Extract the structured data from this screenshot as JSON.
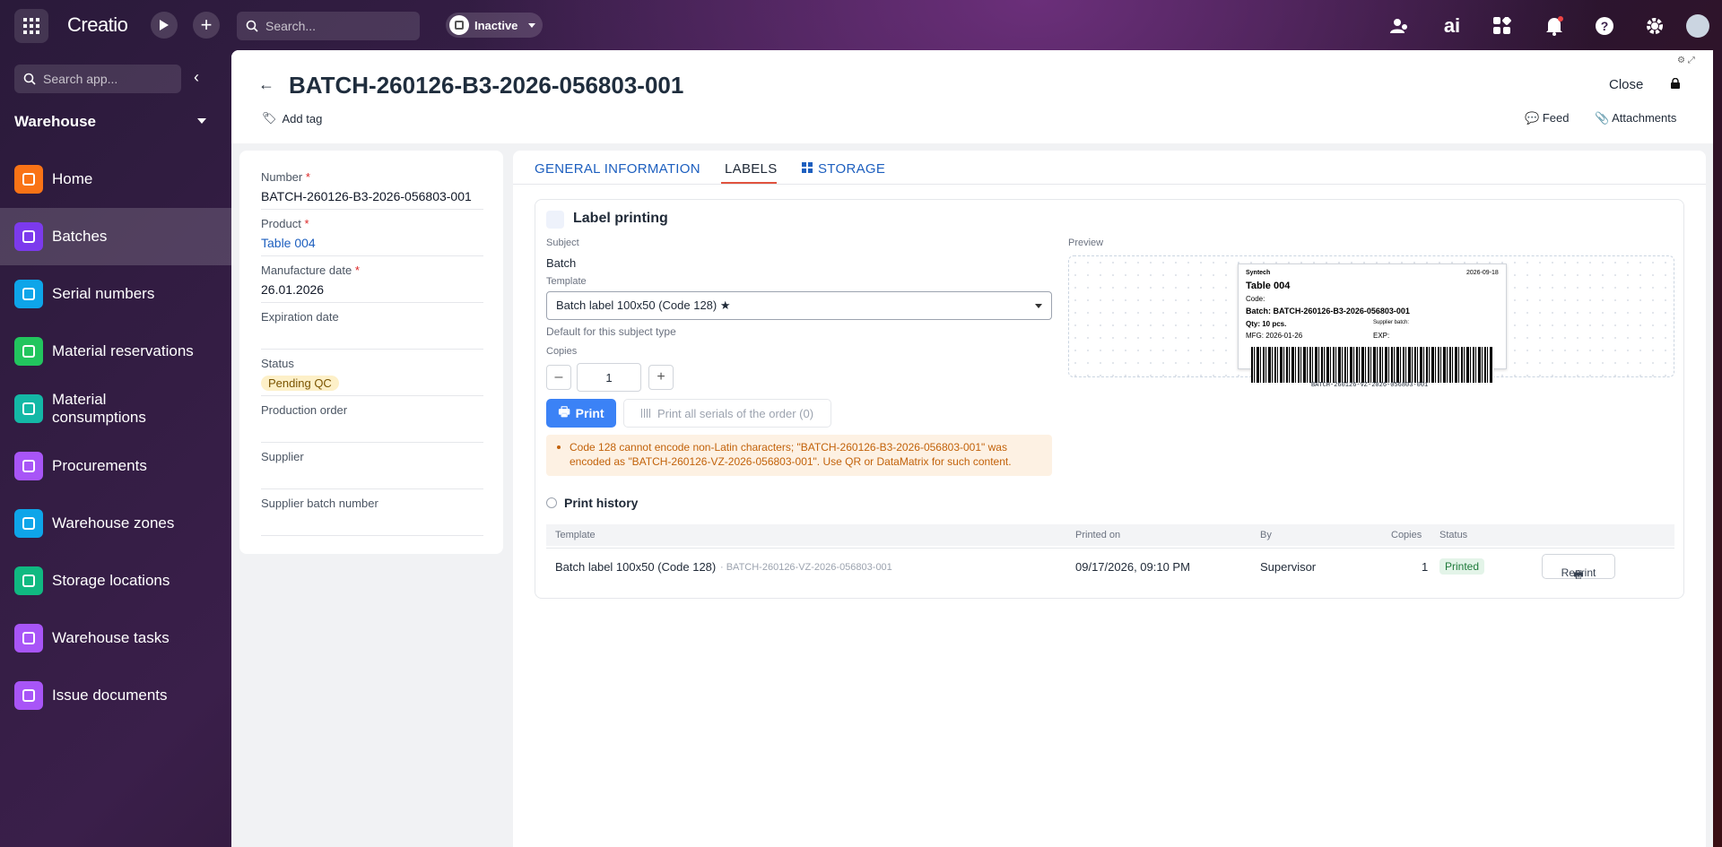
{
  "topbar": {
    "logo": "Creatio",
    "search_placeholder": "Search...",
    "status": "Inactive"
  },
  "sidebar": {
    "search_placeholder": "Search app...",
    "workspace": "Warehouse",
    "items": [
      {
        "label": "Home",
        "color": "#f97316"
      },
      {
        "label": "Batches",
        "color": "#7c3aed"
      },
      {
        "label": "Serial numbers",
        "color": "#0ea5e9"
      },
      {
        "label": "Material reservations",
        "color": "#22c55e"
      },
      {
        "label": "Material consumptions",
        "color": "#14b8a6"
      },
      {
        "label": "Procurements",
        "color": "#a855f7"
      },
      {
        "label": "Warehouse zones",
        "color": "#0ea5e9"
      },
      {
        "label": "Storage locations",
        "color": "#10b981"
      },
      {
        "label": "Warehouse tasks",
        "color": "#a855f7"
      },
      {
        "label": "Issue documents",
        "color": "#a855f7"
      }
    ]
  },
  "header": {
    "title": "BATCH-260126-B3-2026-056803-001",
    "add_tag": "Add tag",
    "close": "Close",
    "feed": "Feed",
    "attachments": "Attachments"
  },
  "fields": {
    "number_label": "Number",
    "number_value": "BATCH-260126-B3-2026-056803-001",
    "product_label": "Product",
    "product_value": "Table 004",
    "mfg_label": "Manufacture date",
    "mfg_value": "26.01.2026",
    "exp_label": "Expiration date",
    "status_label": "Status",
    "status_value": "Pending QC",
    "po_label": "Production order",
    "supplier_label": "Supplier",
    "supplier_batch_label": "Supplier batch number",
    "required_mark": "*"
  },
  "tabs": {
    "general": "GENERAL INFORMATION",
    "labels": "LABELS",
    "storage": "STORAGE"
  },
  "label_printing": {
    "title": "Label printing",
    "subject_label": "Subject",
    "subject_value": "Batch",
    "template_label": "Template",
    "template_value": "Batch label 100x50 (Code 128) ★",
    "template_hint": "Default for this subject type",
    "copies_label": "Copies",
    "copies_value": "1",
    "print": "Print",
    "print_all": "Print all serials of the order (0)",
    "warning": "Code 128 cannot encode non-Latin characters; \"BATCH-260126-B3-2026-056803-001\" was encoded as \"BATCH-260126-VZ-2026-056803-001\". Use QR or DataMatrix for such content.",
    "preview_label": "Preview"
  },
  "label_preview": {
    "brand": "Syntech",
    "date": "2026-09-18",
    "product": "Table 004",
    "code": "Code:",
    "batch": "Batch: BATCH-260126-B3-2026-056803-001",
    "qty": "Qty: 10 pcs.",
    "supplier_batch": "Supplier batch:",
    "mfg": "MFG: 2026-01-26",
    "exp": "EXP:",
    "barcode_text": "BATCH-260126-VZ-2026-056803-001"
  },
  "history": {
    "title": "Print history",
    "columns": {
      "template": "Template",
      "printed_on": "Printed on",
      "by": "By",
      "copies": "Copies",
      "status": "Status"
    },
    "rows": [
      {
        "template": "Batch label 100x50 (Code 128)",
        "code": "· BATCH-260126-VZ-2026-056803-001",
        "printed_on": "09/17/2026, 09:10 PM",
        "by": "Supervisor",
        "copies": "1",
        "status": "Printed",
        "reprint": "Reprint"
      }
    ]
  }
}
